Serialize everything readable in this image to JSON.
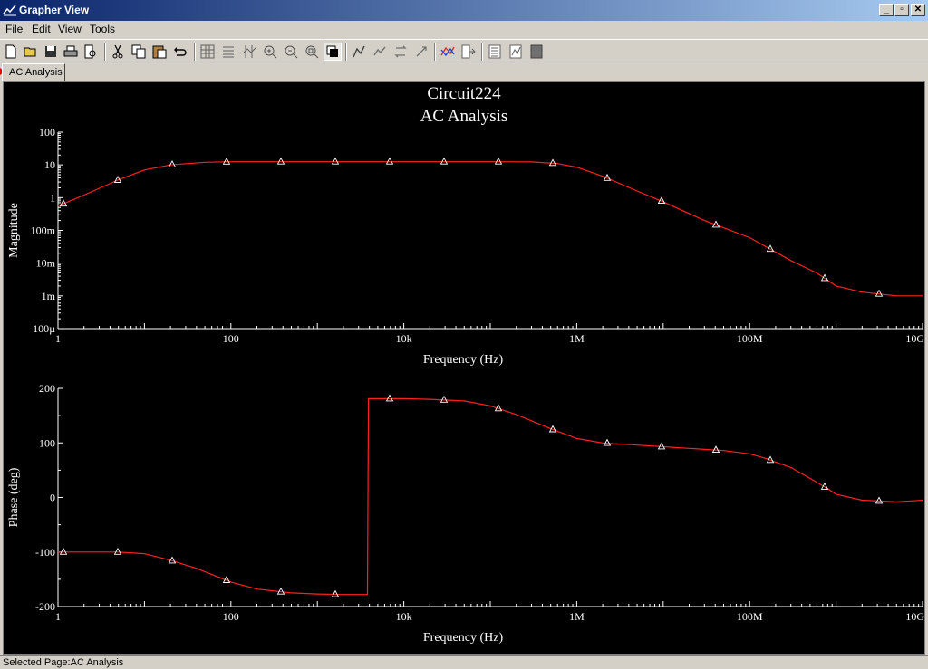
{
  "window": {
    "title": "Grapher View",
    "controls": {
      "minimize": "_",
      "restore": "▫",
      "close": "✕"
    }
  },
  "menu": [
    "File",
    "Edit",
    "View",
    "Tools"
  ],
  "toolbar": {
    "groups": [
      [
        "new-icon",
        "open-icon",
        "save-icon",
        "print-icon",
        "print-preview-icon"
      ],
      [
        "cut-icon",
        "copy-icon",
        "paste-icon",
        "undo-icon"
      ],
      [
        "grid-icon",
        "legend-icon",
        "cursors-icon",
        "zoom-in-icon",
        "zoom-out-icon",
        "zoom-full-icon",
        "black-background-icon"
      ],
      [
        "select-trace-icon",
        "select-marks-icon",
        "reverse-colors-icon",
        "properties-icon"
      ],
      [
        "overlay-traces-icon",
        "export-icon"
      ],
      [
        "page-properties-icon",
        "graph-properties-icon",
        "trace-properties-icon"
      ]
    ]
  },
  "tab": {
    "label": "AC Analysis"
  },
  "plot": {
    "title": "Circuit224",
    "subtitle": "AC Analysis",
    "background": "#000000",
    "trace_color": "#ff2020",
    "axis_color": "#ffffff"
  },
  "chart_data": [
    {
      "type": "line",
      "title": "Circuit224",
      "subtitle": "AC Analysis",
      "xlabel": "Frequency (Hz)",
      "ylabel": "Magnitude",
      "xscale": "log",
      "yscale": "log",
      "xlim": [
        1,
        10000000000
      ],
      "ylim": [
        0.0001,
        100
      ],
      "x_ticks": [
        "1",
        "100",
        "10k",
        "1M",
        "100M",
        "10G"
      ],
      "y_ticks": [
        "100µ",
        "1m",
        "10m",
        "100m",
        "1",
        "10",
        "100"
      ],
      "series": [
        {
          "x": [
            1,
            2,
            5,
            10,
            20,
            50,
            100,
            200,
            500,
            1000,
            4000,
            10000,
            40000,
            100000,
            300000,
            600000,
            1000000,
            2000000,
            5000000,
            10000000,
            30000000,
            100000000,
            300000000,
            600000000,
            1000000000,
            2000000000,
            5000000000,
            10000000000
          ],
          "y": [
            0.55,
            1.2,
            3.5,
            7,
            10,
            12,
            12.5,
            12.5,
            12.5,
            12.5,
            12.5,
            12.5,
            12.5,
            12.5,
            12.3,
            11,
            8.5,
            4.5,
            1.6,
            0.75,
            0.2,
            0.06,
            0.012,
            0.005,
            0.002,
            0.0013,
            0.001,
            0.001
          ]
        }
      ]
    },
    {
      "type": "line",
      "xlabel": "Frequency (Hz)",
      "ylabel": "Phase (deg)",
      "xscale": "log",
      "xlim": [
        1,
        10000000000
      ],
      "ylim": [
        -200,
        200
      ],
      "x_ticks": [
        "1",
        "100",
        "10k",
        "1M",
        "100M",
        "10G"
      ],
      "y_ticks": [
        "-200",
        "-100",
        "0",
        "100",
        "200"
      ],
      "series": [
        {
          "x": [
            1,
            5,
            10,
            20,
            40,
            100,
            200,
            500,
            1000,
            2000,
            3800,
            3900,
            5000,
            10000,
            20000,
            50000,
            100000,
            200000,
            500000,
            1000000,
            2000000,
            5000000,
            10000000,
            20000000,
            50000000,
            100000000,
            150000000,
            300000000,
            500000000,
            800000000,
            1000000000,
            2000000000,
            5000000000,
            10000000000
          ],
          "y": [
            -100,
            -100,
            -103,
            -115,
            -130,
            -155,
            -168,
            -175,
            -177,
            -178,
            -178,
            181,
            181,
            181,
            180,
            177,
            168,
            152,
            126,
            108,
            100,
            96,
            93,
            90,
            86,
            80,
            72,
            55,
            35,
            16,
            6,
            -5,
            -8,
            -5
          ]
        }
      ]
    }
  ],
  "status": {
    "text": "Selected Page:AC Analysis"
  }
}
